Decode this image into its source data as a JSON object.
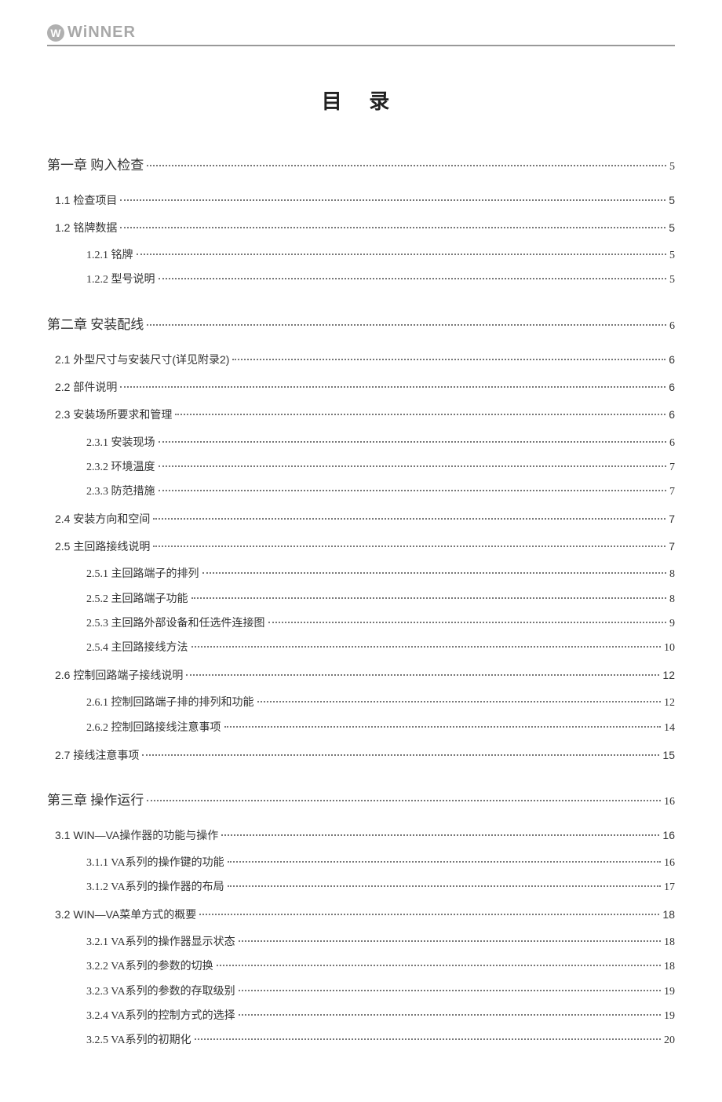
{
  "brand": "WiNNER",
  "title": "目  录",
  "toc": [
    {
      "level": "chapter",
      "label": "第一章  购入检查",
      "page": "5"
    },
    {
      "level": "section",
      "label": "1.1  检查项目",
      "page": "5"
    },
    {
      "level": "section",
      "label": "1.2  铭牌数据",
      "page": "5"
    },
    {
      "level": "sub",
      "label": "1.2.1  铭牌",
      "page": "5"
    },
    {
      "level": "sub",
      "label": "1.2.2  型号说明",
      "page": "5"
    },
    {
      "level": "chapter",
      "label": "第二章  安装配线",
      "page": "6"
    },
    {
      "level": "section",
      "label": "2.1  外型尺寸与安装尺寸(详见附录2)",
      "page": "6"
    },
    {
      "level": "section",
      "label": "2.2  部件说明",
      "page": "6"
    },
    {
      "level": "section",
      "label": "2.3  安装场所要求和管理",
      "page": "6"
    },
    {
      "level": "sub",
      "label": "2.3.1  安装现场",
      "page": "6"
    },
    {
      "level": "sub",
      "label": "2.3.2  环境温度",
      "page": "7"
    },
    {
      "level": "sub",
      "label": "2.3.3  防范措施",
      "page": "7"
    },
    {
      "level": "section",
      "label": "2.4  安装方向和空间",
      "page": "7"
    },
    {
      "level": "section",
      "label": "2.5  主回路接线说明",
      "page": "7"
    },
    {
      "level": "sub",
      "label": "2.5.1  主回路端子的排列",
      "page": "8"
    },
    {
      "level": "sub",
      "label": "2.5.2  主回路端子功能",
      "page": "8"
    },
    {
      "level": "sub",
      "label": "2.5.3  主回路外部设备和任选件连接图",
      "page": "9"
    },
    {
      "level": "sub",
      "label": "2.5.4  主回路接线方法",
      "page": "10"
    },
    {
      "level": "section",
      "label": "2.6  控制回路端子接线说明",
      "page": "12"
    },
    {
      "level": "sub",
      "label": "2.6.1  控制回路端子排的排列和功能",
      "page": "12"
    },
    {
      "level": "sub",
      "label": "2.6.2  控制回路接线注意事项",
      "page": "14"
    },
    {
      "level": "section",
      "label": "2.7  接线注意事项",
      "page": "15"
    },
    {
      "level": "chapter",
      "label": "第三章  操作运行",
      "page": "16"
    },
    {
      "level": "section",
      "label": "3.1  WIN—VA操作器的功能与操作",
      "page": "16"
    },
    {
      "level": "sub",
      "label": "3.1.1  VA系列的操作键的功能",
      "page": "16"
    },
    {
      "level": "sub",
      "label": "3.1.2  VA系列的操作器的布局",
      "page": "17"
    },
    {
      "level": "section",
      "label": "3.2  WIN—VA菜单方式的概要",
      "page": "18"
    },
    {
      "level": "sub",
      "label": "3.2.1  VA系列的操作器显示状态",
      "page": "18"
    },
    {
      "level": "sub",
      "label": "3.2.2  VA系列的参数的切换",
      "page": "18"
    },
    {
      "level": "sub",
      "label": "3.2.3  VA系列的参数的存取级别",
      "page": "19"
    },
    {
      "level": "sub",
      "label": "3.2.4  VA系列的控制方式的选择",
      "page": "19"
    },
    {
      "level": "sub",
      "label": "3.2.5  VA系列的初期化",
      "page": "20"
    }
  ]
}
